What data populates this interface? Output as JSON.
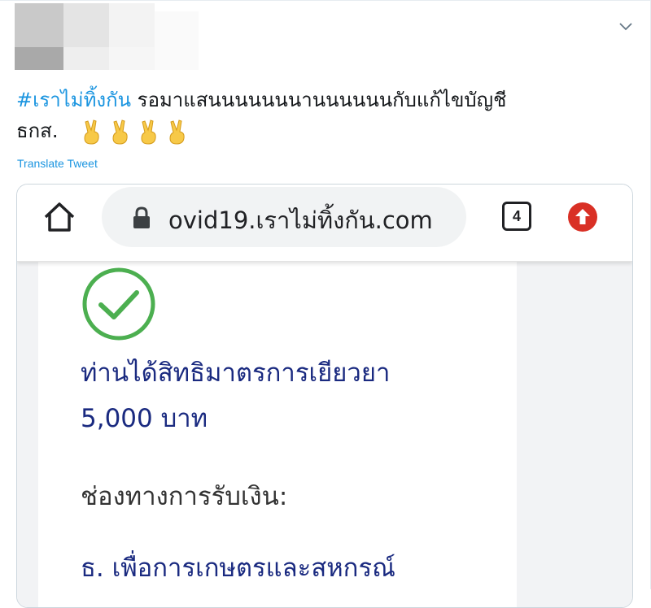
{
  "tweet": {
    "hashtag": "#เราไม่ทิ้งกัน",
    "text_after_hashtag": " รอมาแสนนนนนนนานนนนนนกับแก้ไขบัญชี",
    "text_line2": "ธกส.",
    "emojis": [
      "victory-hand",
      "victory-hand",
      "victory-hand",
      "victory-hand"
    ],
    "translate_label": "Translate Tweet"
  },
  "browser": {
    "url": "ovid19.เราไม่ทิ้งกัน.com",
    "tab_count": "4",
    "icons": [
      "home-icon",
      "lock-icon",
      "tab-switcher-icon",
      "update-icon"
    ]
  },
  "page": {
    "eligible_line1": "ท่านได้สิทธิมาตรการเยียวยา",
    "eligible_line2": "5,000 บาท",
    "channel_label": "ช่องทางการรับเงิน:",
    "bank": "ธ. เพื่อการเกษตรและสหกรณ์"
  },
  "colors": {
    "link": "#1b95e0",
    "check_green": "#4caf50",
    "page_blue": "#1a2a80",
    "update_red": "#d93025"
  }
}
